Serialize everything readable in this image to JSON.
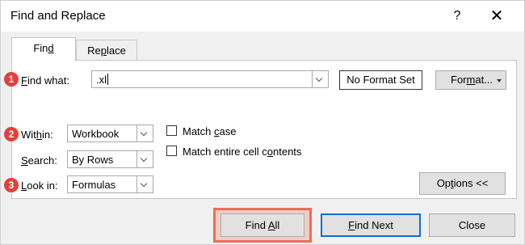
{
  "window": {
    "title": "Find and Replace",
    "help_glyph": "?",
    "close_glyph": "✕"
  },
  "tabs": [
    {
      "pre": "Fin",
      "key": "d",
      "post": "",
      "active": true
    },
    {
      "pre": "Re",
      "key": "p",
      "post": "lace",
      "active": false
    }
  ],
  "find": {
    "label_pre": "",
    "label_key": "F",
    "label_post": "ind what:",
    "value": ".xl"
  },
  "format": {
    "no_format": "No Format Set",
    "format_pre": "For",
    "format_key": "m",
    "format_post": "at..."
  },
  "within": {
    "label_pre": "Wit",
    "label_key": "h",
    "label_post": "in:",
    "value": "Workbook"
  },
  "search": {
    "label_pre": "",
    "label_key": "S",
    "label_post": "earch:",
    "value": "By Rows"
  },
  "look_in": {
    "label_pre": "",
    "label_key": "L",
    "label_post": "ook in:",
    "value": "Formulas"
  },
  "checks": {
    "match_case_pre": "Match ",
    "match_case_key": "c",
    "match_case_post": "ase",
    "match_entire_pre": "Match entire cell c",
    "match_entire_key": "o",
    "match_entire_post": "ntents"
  },
  "options": {
    "pre": "Op",
    "key": "t",
    "post": "ions <<"
  },
  "markers": [
    "1",
    "2",
    "3"
  ],
  "buttons": {
    "find_all_pre": "Find ",
    "find_all_key": "A",
    "find_all_post": "ll",
    "find_next_pre": "",
    "find_next_key": "F",
    "find_next_post": "ind Next",
    "close": "Close"
  },
  "colors": {
    "marker": "#e2403a",
    "highlight": "#ef6c5a",
    "focus": "#0b6fd3"
  }
}
